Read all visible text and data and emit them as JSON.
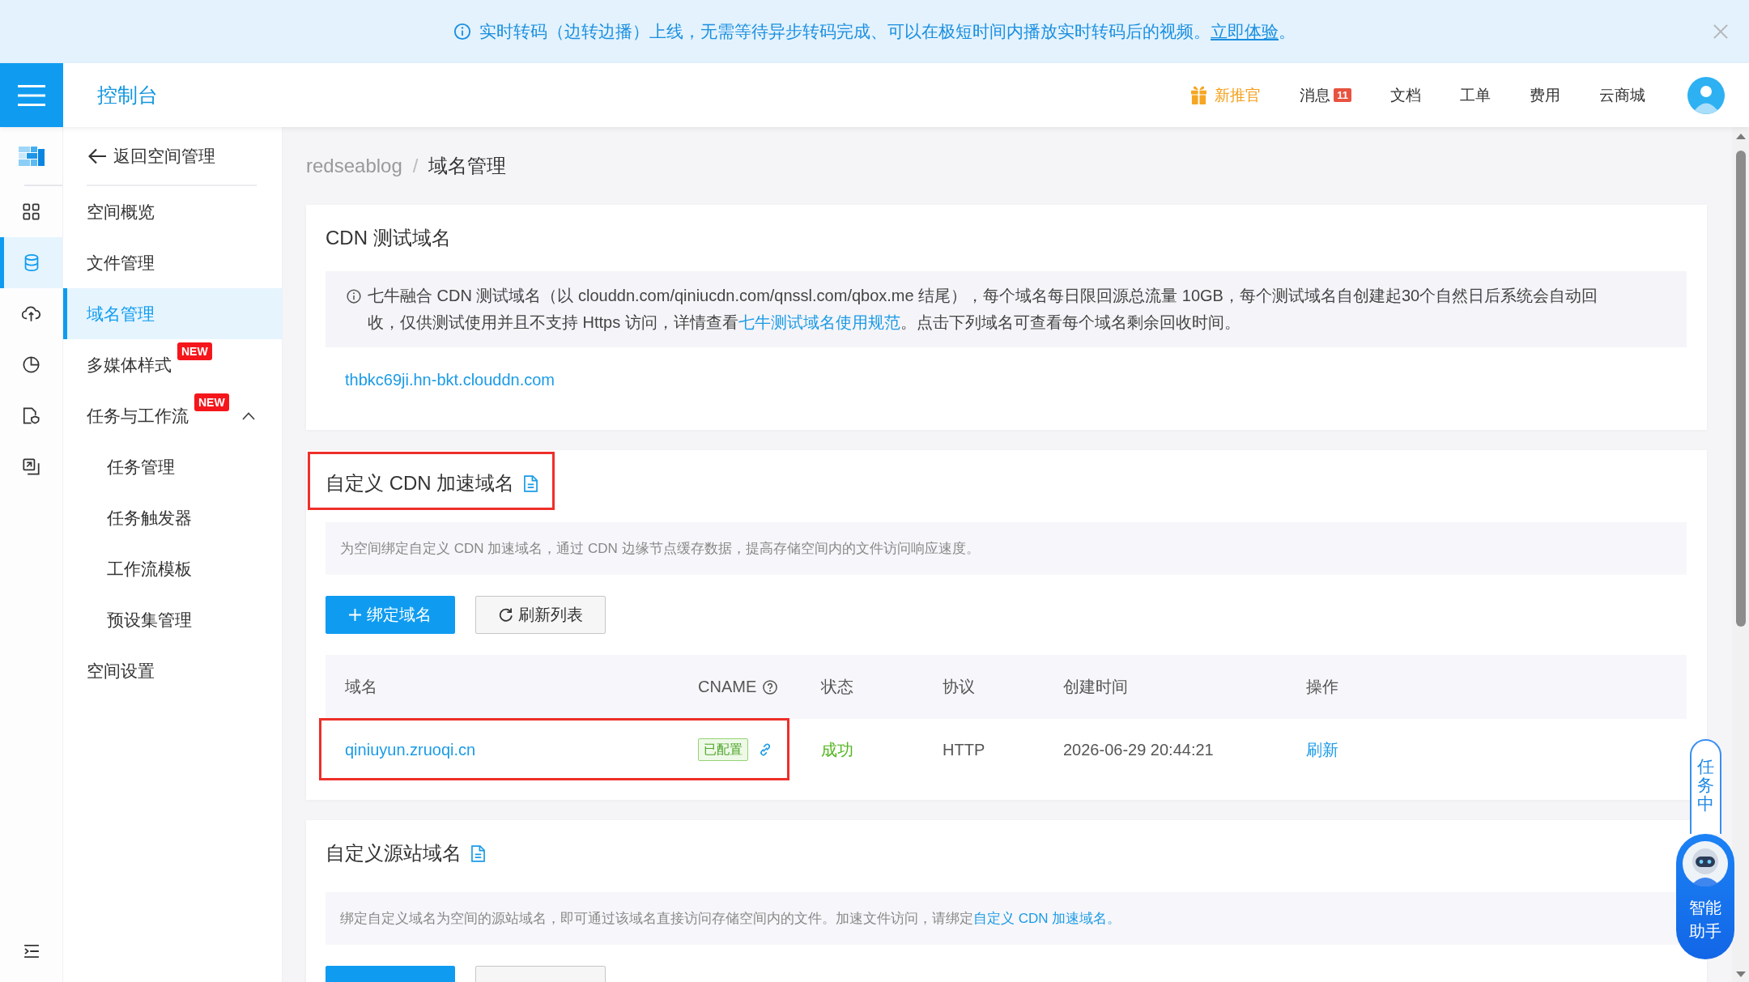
{
  "banner": {
    "text": "实时转码（边转边播）上线，无需等待异步转码完成、可以在极短时间内播放实时转码后的视频。",
    "link": "立即体验",
    "suffix": "。"
  },
  "header": {
    "title": "控制台",
    "nav": [
      {
        "kind": "promo",
        "label": "新推官"
      },
      {
        "kind": "messages",
        "label": "消息",
        "badge": "11"
      },
      {
        "kind": "plain",
        "label": "文档"
      },
      {
        "kind": "plain",
        "label": "工单"
      },
      {
        "kind": "plain",
        "label": "费用"
      },
      {
        "kind": "plain",
        "label": "云商城"
      }
    ]
  },
  "rail": {
    "items": [
      {
        "kind": "grid",
        "selected": false
      },
      {
        "kind": "database",
        "selected": true
      },
      {
        "kind": "cloud",
        "selected": false
      },
      {
        "kind": "pie",
        "selected": false
      },
      {
        "kind": "file-shield",
        "selected": false
      },
      {
        "kind": "copy",
        "selected": false
      }
    ]
  },
  "subnav": {
    "back": "返回空间管理",
    "items": [
      {
        "label": "空间概览",
        "selected": false
      },
      {
        "label": "文件管理",
        "selected": false
      },
      {
        "label": "域名管理",
        "selected": true
      },
      {
        "label": "多媒体样式",
        "selected": false,
        "badge": "NEW"
      },
      {
        "label": "任务与工作流",
        "selected": false,
        "badge": "NEW",
        "expanded": true,
        "children": [
          {
            "label": "任务管理",
            "selected": false
          },
          {
            "label": "任务触发器",
            "selected": false
          },
          {
            "label": "工作流模板",
            "selected": false
          },
          {
            "label": "预设集管理",
            "selected": false
          }
        ]
      },
      {
        "label": "空间设置",
        "selected": false
      }
    ]
  },
  "breadcrumb": {
    "separator": "/",
    "items": [
      {
        "label": "redseablog",
        "current": false
      },
      {
        "label": "域名管理",
        "current": true
      }
    ]
  },
  "sections": [
    {
      "title": "CDN 测试域名",
      "doc_icon": false,
      "highlighted": false,
      "notice": {
        "before": "七牛融合 CDN 测试域名（以 clouddn.com/qiniucdn.com/qnssl.com/qbox.me 结尾），每个域名每日限回源总流量 10GB，每个测试域名自创建起30个自然日后系统会自动回收，仅供测试使用并且不支持 Https 访问，详情查看",
        "link": "七牛测试域名使用规范",
        "after": "。点击下列域名可查看每个域名剩余回收时间。"
      },
      "domains": [
        "thbkc69ji.hn-bkt.clouddn.com"
      ]
    },
    {
      "title": "自定义 CDN 加速域名",
      "doc_icon": true,
      "highlighted": true,
      "description": {
        "text": "为空间绑定自定义 CDN 加速域名，通过 CDN 边缘节点缓存数据，提高存储空间内的文件访问响应速度。"
      },
      "buttons": [
        {
          "kind": "primary",
          "label": "绑定域名"
        },
        {
          "kind": "default",
          "label": "刷新列表"
        }
      ],
      "table": {
        "columns": [
          {
            "label": "域名",
            "help": false
          },
          {
            "label": "CNAME",
            "help": true
          },
          {
            "label": "状态",
            "help": false
          },
          {
            "label": "协议",
            "help": false
          },
          {
            "label": "创建时间",
            "help": false
          },
          {
            "label": "操作",
            "help": false
          }
        ],
        "rows": [
          {
            "domain": "qiniuyun.zruoqi.cn",
            "cname": "已配置",
            "status": "成功",
            "protocol": "HTTP",
            "created": "2026-06-29 20:44:21",
            "action": "刷新",
            "highlighted": true
          }
        ]
      }
    },
    {
      "title": "自定义源站域名",
      "doc_icon": true,
      "highlighted": false,
      "description": {
        "text": "绑定自定义域名为空间的源站域名，即可通过该域名直接访问存储空间内的文件。加速文件访问，请绑定",
        "link": "自定义 CDN 加速域名。"
      },
      "buttons": [
        {
          "kind": "primary"
        },
        {
          "kind": "default"
        }
      ]
    }
  ],
  "task_center": {
    "label": "任务中"
  },
  "assistant": {
    "label": "智能助手"
  }
}
